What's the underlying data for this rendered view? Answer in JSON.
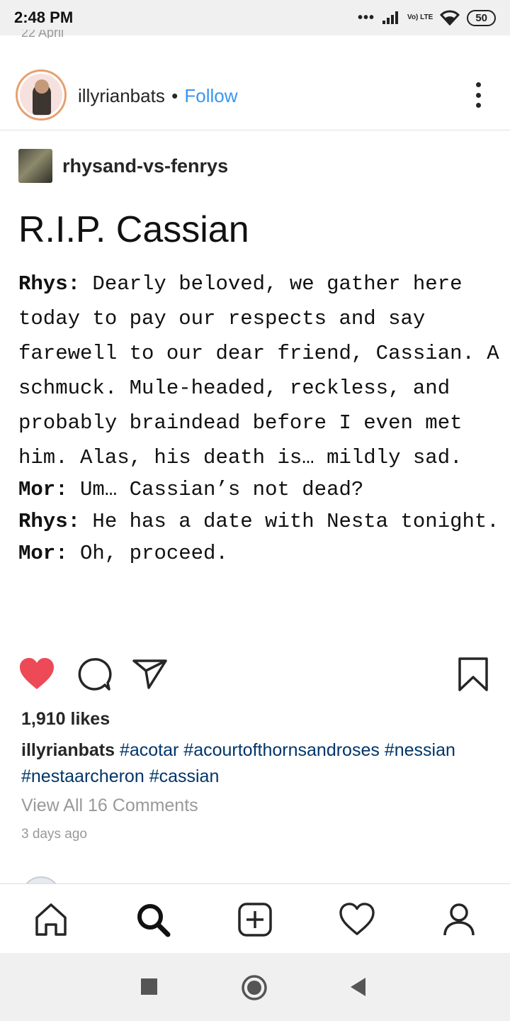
{
  "status_bar": {
    "time": "2:48 PM",
    "signal_dots": "•••",
    "volte_label": "Vo) LTE",
    "battery": "50"
  },
  "peek_text": "22 April",
  "header": {
    "username": "illyrianbats",
    "separator": "•",
    "follow_label": "Follow"
  },
  "source": {
    "name": "rhysand-vs-fenrys"
  },
  "post": {
    "title": "R.I.P. Cassian",
    "lines": [
      {
        "speaker": "Rhys:",
        "text": " Dearly beloved, we gather here today to pay our respects and say farewell to our dear friend, Cassian. A schmuck. Mule-headed, reckless, and probably braindead before I even met him. Alas, his death is… mildly sad."
      },
      {
        "speaker": "Mor:",
        "text": " Um… Cassian’s not dead?"
      },
      {
        "speaker": "Rhys:",
        "text": " He has a date with Nesta tonight."
      },
      {
        "speaker": "Mor:",
        "text": " Oh, proceed."
      }
    ]
  },
  "actions": {
    "like_icon": "heart-filled-icon",
    "comment_icon": "comment-icon",
    "share_icon": "paper-plane-icon",
    "save_icon": "bookmark-icon",
    "like_color": "#ed4956"
  },
  "likes": "1,910 likes",
  "caption": {
    "username": "illyrianbats",
    "hashtags": [
      "#acotar",
      "#acourtofthornsandroses",
      "#nessian",
      "#nestaarcheron",
      "#cassian"
    ]
  },
  "comments_link": "View All 16 Comments",
  "timestamp": "3 days ago",
  "bottom_nav": {
    "items": [
      "home-icon",
      "search-icon",
      "new-post-icon",
      "activity-heart-icon",
      "profile-icon"
    ]
  },
  "system_nav": {
    "items": [
      "recents-square-icon",
      "home-circle-icon",
      "back-triangle-icon"
    ]
  },
  "colors": {
    "link_blue": "#3897f0",
    "hashtag_blue": "#003569",
    "muted_gray": "#999999"
  }
}
